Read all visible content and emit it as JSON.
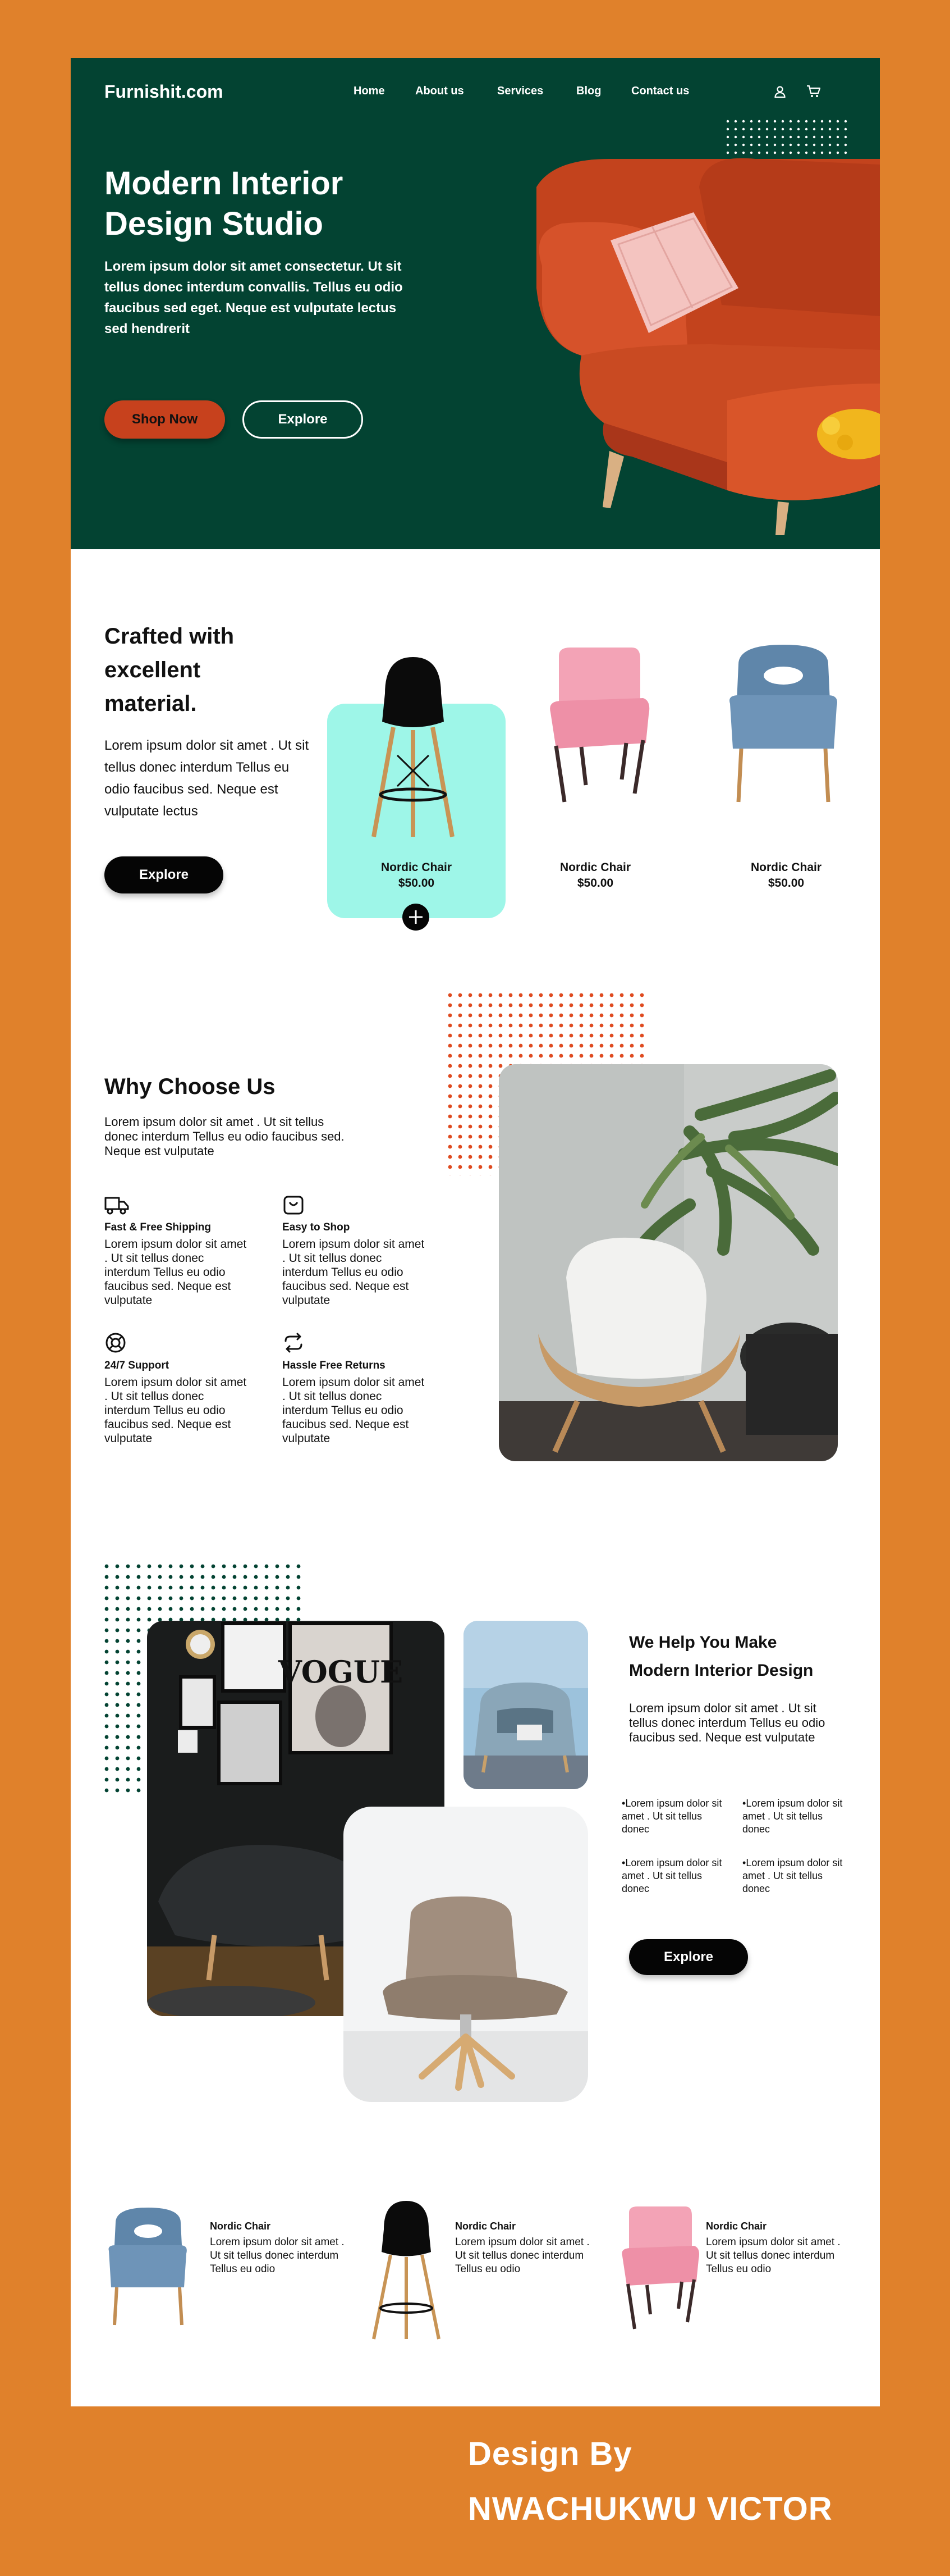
{
  "brand": {
    "name": "Furnishit.com"
  },
  "nav": {
    "items": [
      "Home",
      "About us",
      "Services",
      "Blog",
      "Contact us"
    ]
  },
  "icons": {
    "user": "user-icon",
    "cart": "cart-icon"
  },
  "colors": {
    "page_bg": "#e0812b",
    "hero_bg": "#034332",
    "accent": "#c7411d",
    "card_highlight": "#9ef6e8"
  },
  "hero": {
    "title": "Modern Interior Design Studio",
    "text": "Lorem ipsum dolor sit amet consectetur. Ut sit tellus donec interdum convallis. Tellus eu odio faucibus sed eget. Neque est vulputate lectus sed hendrerit",
    "shop_label": "Shop Now",
    "explore_label": "Explore"
  },
  "crafted": {
    "title": "Crafted with excellent material.",
    "text": "Lorem ipsum dolor sit amet . Ut sit tellus donec interdum Tellus eu odio faucibus sed. Neque est vulputate lectus",
    "explore_label": "Explore",
    "products": [
      {
        "name": "Nordic Chair",
        "price": "$50.00"
      },
      {
        "name": "Nordic Chair",
        "price": "$50.00"
      },
      {
        "name": "Nordic Chair",
        "price": "$50.00"
      }
    ],
    "add_icon": "plus-circle-icon"
  },
  "why": {
    "title": "Why Choose Us",
    "text": "Lorem ipsum dolor sit amet . Ut sit tellus donec interdum  Tellus eu odio faucibus sed. Neque est vulputate",
    "features": [
      {
        "icon": "truck-icon",
        "title": "Fast & Free Shipping",
        "text": "Lorem ipsum dolor sit amet . Ut sit tellus donec interdum  Tellus eu odio faucibus sed. Neque est vulputate"
      },
      {
        "icon": "bag-icon",
        "title": "Easy to Shop",
        "text": "Lorem ipsum dolor sit amet . Ut sit tellus donec interdum  Tellus eu odio faucibus sed. Neque est vulputate"
      },
      {
        "icon": "support-icon",
        "title": "24/7 Support",
        "text": "Lorem ipsum dolor sit amet . Ut sit tellus donec interdum  Tellus eu odio faucibus sed. Neque est vulputate"
      },
      {
        "icon": "returns-icon",
        "title": "Hassle Free Returns",
        "text": "Lorem ipsum dolor sit amet . Ut sit tellus donec interdum  Tellus eu odio faucibus sed. Neque est vulputate"
      }
    ]
  },
  "help": {
    "title": "We Help You Make Modern Interior Design",
    "text": "Lorem ipsum dolor sit amet . Ut sit tellus donec interdum  Tellus eu odio faucibus sed. Neque est vulputate",
    "bullets": [
      "Lorem ipsum dolor sit amet . Ut sit tellus donec",
      "Lorem ipsum dolor sit amet . Ut sit tellus donec",
      "Lorem ipsum dolor sit amet . Ut sit tellus donec",
      "Lorem ipsum dolor sit amet . Ut sit tellus donec"
    ],
    "explore_label": "Explore",
    "poster_text": "VOGUE"
  },
  "bottom_products": [
    {
      "name": "Nordic Chair",
      "text": "Lorem ipsum dolor sit amet . Ut sit tellus donec interdum  Tellus eu odio"
    },
    {
      "name": "Nordic Chair",
      "text": "Lorem ipsum dolor sit amet . Ut sit tellus donec interdum  Tellus eu odio"
    },
    {
      "name": "Nordic Chair",
      "text": "Lorem ipsum dolor sit amet . Ut sit tellus donec interdum  Tellus eu odio"
    }
  ],
  "credit": {
    "line1": "Design By",
    "line2": "NWACHUKWU VICTOR"
  }
}
